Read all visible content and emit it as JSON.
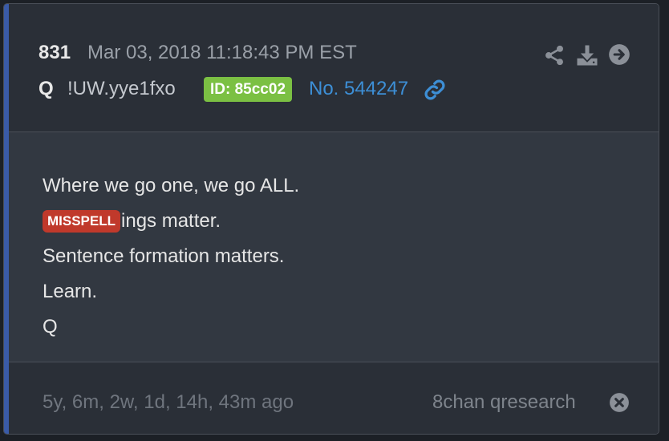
{
  "post": {
    "number": "831",
    "date": "Mar 03, 2018 11:18:43 PM EST",
    "poster_name": "Q",
    "tripcode": "!UW.yye1fxo",
    "id_badge": "ID: 85cc02",
    "post_no": "No. 544247"
  },
  "header_actions": {
    "share_icon": "share-icon",
    "download_icon": "download-icon",
    "next_icon": "arrow-right-circle-icon"
  },
  "body": {
    "line1": "Where we go one, we go ALL.",
    "misspell_tag": "MISSPELL",
    "line2_rest": "ings matter.",
    "line3": "Sentence formation matters.",
    "line4": "Learn.",
    "line5": "Q"
  },
  "footer": {
    "ago": "5y, 6m, 2w, 1d, 14h, 43m ago",
    "source": "8chan qresearch"
  },
  "colors": {
    "accent": "#3a5ba8",
    "id_badge": "#7bc043",
    "link": "#3d8fd6",
    "misspell": "#c0392b"
  }
}
